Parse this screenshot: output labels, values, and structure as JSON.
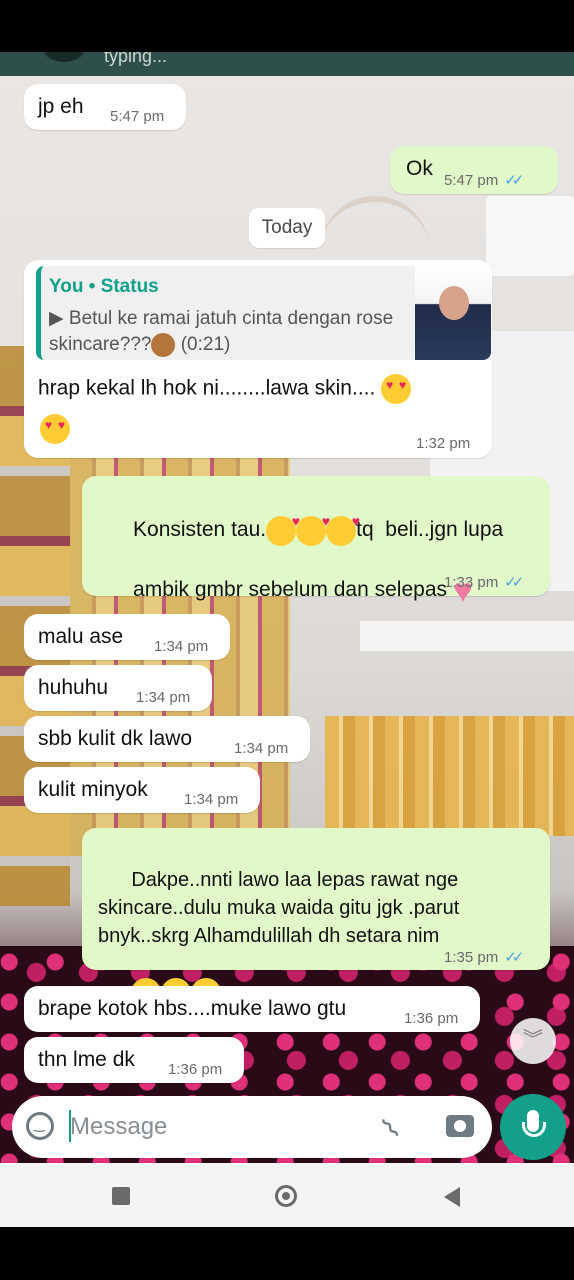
{
  "header": {
    "status_text": "typing..."
  },
  "date_chip": "Today",
  "composer": {
    "placeholder": "Message"
  },
  "colors": {
    "outgoing_bubble": "#e1f9c9",
    "incoming_bubble": "#ffffff",
    "accent": "#13a08a",
    "read_ticks": "#4aa3e6"
  },
  "messages": [
    {
      "dir": "in",
      "text": "jp eh",
      "time": "5:47 pm"
    },
    {
      "dir": "out",
      "text": "Ok",
      "time": "5:47 pm",
      "ticks": "✓✓"
    },
    {
      "dir": "in",
      "quote_title": "You • Status",
      "quote_text": "Betul ke ramai jatuh cinta dengan rose skincare???",
      "quote_duration": "(0:21)",
      "text": "hrap kekal lh hok ni........lawa skin....",
      "time": "1:32 pm"
    },
    {
      "dir": "out",
      "text_a": "Konsisten tau.",
      "text_b": "tq  beli..jgn lupa",
      "text_c": "ambik gmbr sebelum dan selepas",
      "time": "1:33 pm",
      "ticks": "✓✓"
    },
    {
      "dir": "in",
      "text": "malu ase",
      "time": "1:34 pm"
    },
    {
      "dir": "in",
      "text": "huhuhu",
      "time": "1:34 pm"
    },
    {
      "dir": "in",
      "text": "sbb kulit dk lawo",
      "time": "1:34 pm"
    },
    {
      "dir": "in",
      "text": "kulit minyok",
      "time": "1:34 pm"
    },
    {
      "dir": "out",
      "text": "Dakpe..nnti lawo laa lepas rawat nge\nskincare..dulu muka waida gitu jgk .parut\nbnyk..skrg Alhamdulillah dh setara nim",
      "time": "1:35 pm",
      "ticks": "✓✓"
    },
    {
      "dir": "in",
      "text": "brape kotok hbs....muke lawo gtu",
      "time": "1:36 pm"
    },
    {
      "dir": "in",
      "text": "thn lme dk",
      "time": "1:36 pm"
    }
  ]
}
